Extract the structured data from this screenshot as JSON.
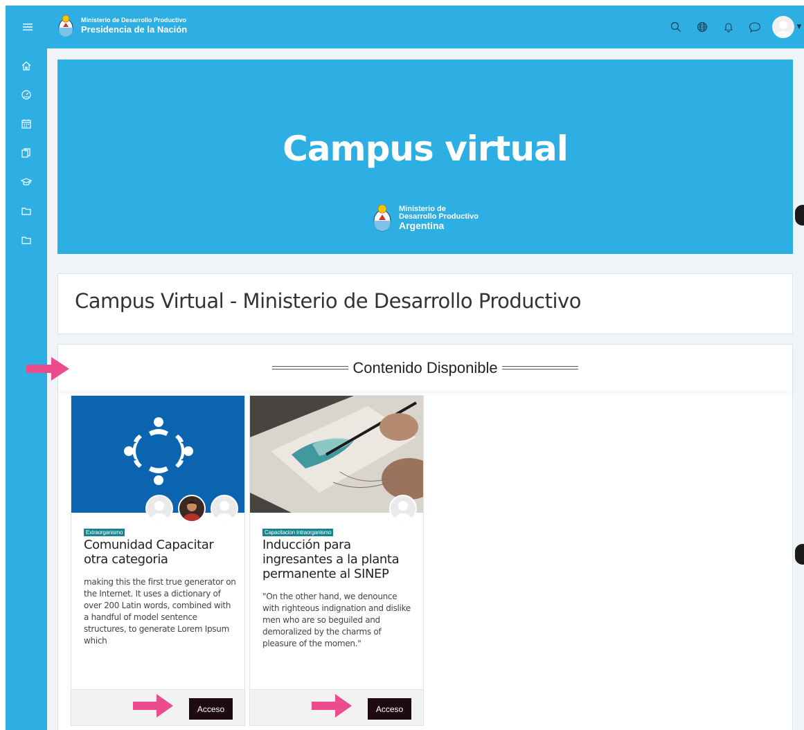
{
  "navbar": {
    "brand_line1": "Ministerio de Desarrollo Productivo",
    "brand_line2": "Presidencia de la Nación",
    "color": "#2eafe3",
    "icons": [
      "menu-icon",
      "search-icon",
      "globe-icon",
      "bell-icon",
      "chat-icon",
      "user-avatar"
    ]
  },
  "sidebar": {
    "items": [
      "home-icon",
      "dashboard-icon",
      "calendar-icon",
      "content-bank-icon",
      "graduation-cap-icon",
      "folder-icon",
      "folder-icon"
    ]
  },
  "hero": {
    "title": "Campus virtual",
    "logo_line1": "Ministerio de",
    "logo_line2": "Desarrollo Productivo",
    "logo_line3": "Argentina"
  },
  "page": {
    "title": "Campus Virtual - Ministerio de Desarrollo Productivo"
  },
  "section": {
    "title": "Contenido Disponible"
  },
  "cards": [
    {
      "tag": "Extraorganismo",
      "title": "Comunidad Capacitar otra categoria",
      "description": "making this the first true generator on the Internet. It uses a dictionary of over 200 Latin words, combined with a handful of model sentence structures, to generate Lorem Ipsum which",
      "button": "Acceso"
    },
    {
      "tag": "Capacitacion Intraorganismo",
      "title": "Inducción para ingresantes a la planta permanente al SINEP",
      "description": "\"On the other hand, we denounce with righteous indignation and dislike men who are so beguiled and demoralized by the charms of pleasure of the momen.\"",
      "button": "Acceso"
    }
  ],
  "colors": {
    "accent": "#2eafe3",
    "tag": "#17838f",
    "button": "#1e0a12",
    "annotation_arrow": "#ec4b8e"
  }
}
